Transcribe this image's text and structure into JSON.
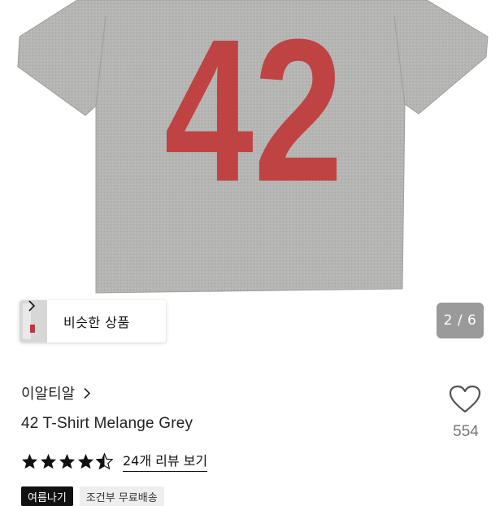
{
  "gallery": {
    "printed_number": "42",
    "counter": "2 / 6",
    "shirt_color": "#b4b4b2",
    "print_color": "#c03a3a"
  },
  "similar": {
    "label": "비슷한 상품"
  },
  "product": {
    "brand": "이알티알",
    "title": "42 T-Shirt Melange Grey",
    "likes": "554",
    "rating": 4.5,
    "review_link": "24개 리뷰 보기"
  },
  "tags": [
    "여름나기",
    "조건부 무료배송"
  ],
  "icons": {
    "brand_chevron": "chevron-right-icon",
    "similar_chevron": "chevron-right-icon",
    "like": "heart-outline-icon",
    "rating": "star-icon"
  }
}
